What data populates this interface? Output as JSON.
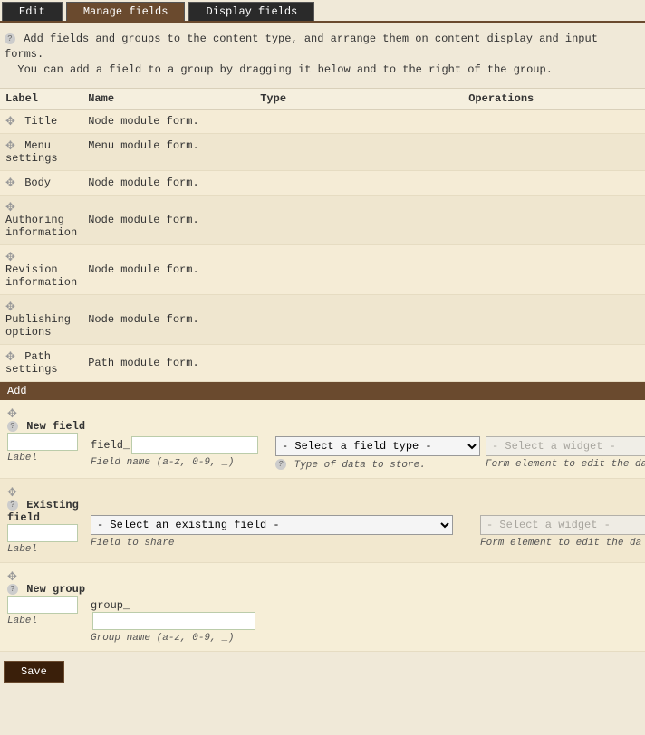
{
  "tabs": {
    "edit": "Edit",
    "manage": "Manage fields",
    "display": "Display fields"
  },
  "help_line1": "Add fields and groups to the content type, and arrange them on content display and input forms.",
  "help_line2": "You can add a field to a group by dragging it below and to the right of the group.",
  "columns": {
    "label": "Label",
    "name": "Name",
    "type": "Type",
    "operations": "Operations"
  },
  "rows": [
    {
      "label": "Title",
      "name": "Node module form."
    },
    {
      "label": "Menu settings",
      "name": "Menu module form."
    },
    {
      "label": "Body",
      "name": "Node module form."
    },
    {
      "label": "Authoring information",
      "name": "Node module form."
    },
    {
      "label": "Revision information",
      "name": "Node module form."
    },
    {
      "label": "Publishing options",
      "name": "Node module form."
    },
    {
      "label": "Path settings",
      "name": "Path module form."
    }
  ],
  "add_header": "Add",
  "new_field": {
    "title": "New field",
    "prefix": "field_",
    "name_hint": "Field name (a-z, 0-9, _)",
    "type_placeholder": "- Select a field type -",
    "type_hint": "Type of data to store.",
    "widget_placeholder": "- Select a widget -",
    "widget_hint": "Form element to edit the da",
    "label_hint": "Label"
  },
  "existing_field": {
    "title": "Existing field",
    "select_placeholder": "- Select an existing field -",
    "select_hint": "Field to share",
    "widget_placeholder": "- Select a widget -",
    "widget_hint": "Form element to edit the da",
    "label_hint": "Label"
  },
  "new_group": {
    "title": "New group",
    "prefix": "group_",
    "name_hint": "Group name (a-z, 0-9, _)",
    "label_hint": "Label"
  },
  "save_label": "Save",
  "icons": {
    "help": "?",
    "drag": "✥"
  }
}
